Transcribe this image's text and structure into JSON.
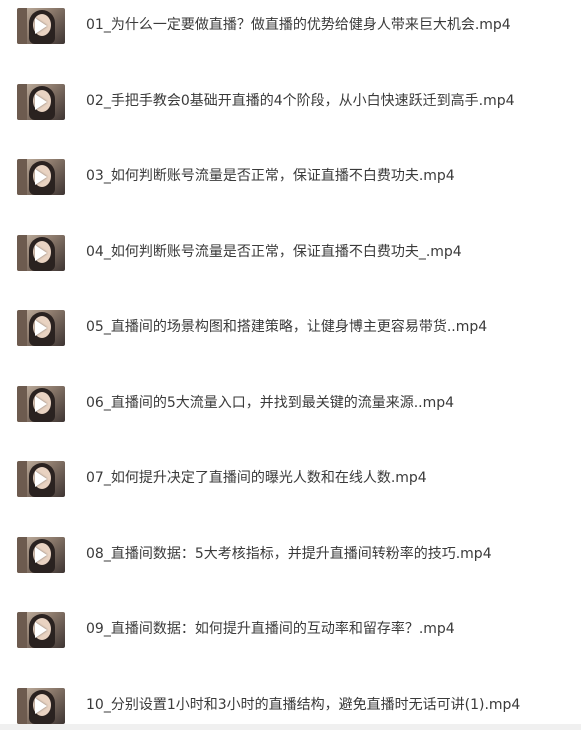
{
  "files": [
    {
      "name": "01_为什么一定要做直播？做直播的优势给健身人带来巨大机会.mp4",
      "icon": "video-thumbnail-icon"
    },
    {
      "name": "02_手把手教会0基础开直播的4个阶段，从小白快速跃迁到高手.mp4",
      "icon": "video-thumbnail-icon"
    },
    {
      "name": "03_如何判断账号流量是否正常，保证直播不白费功夫.mp4",
      "icon": "video-thumbnail-icon"
    },
    {
      "name": "04_如何判断账号流量是否正常，保证直播不白费功夫_.mp4",
      "icon": "video-thumbnail-icon"
    },
    {
      "name": "05_直播间的场景构图和搭建策略，让健身博主更容易带货..mp4",
      "icon": "video-thumbnail-icon"
    },
    {
      "name": "06_直播间的5大流量入口，并找到最关键的流量来源..mp4",
      "icon": "video-thumbnail-icon"
    },
    {
      "name": "07_如何提升决定了直播间的曝光人数和在线人数.mp4",
      "icon": "video-thumbnail-icon"
    },
    {
      "name": "08_直播间数据：5大考核指标，并提升直播间转粉率的技巧.mp4",
      "icon": "video-thumbnail-icon"
    },
    {
      "name": "09_直播间数据：如何提升直播间的互动率和留存率？.mp4",
      "icon": "video-thumbnail-icon"
    },
    {
      "name": "10_分别设置1小时和3小时的直播结构，避免直播时无话可讲(1).mp4",
      "icon": "video-thumbnail-icon"
    }
  ],
  "colors": {
    "text": "#3a3a3a",
    "background": "#ffffff"
  }
}
